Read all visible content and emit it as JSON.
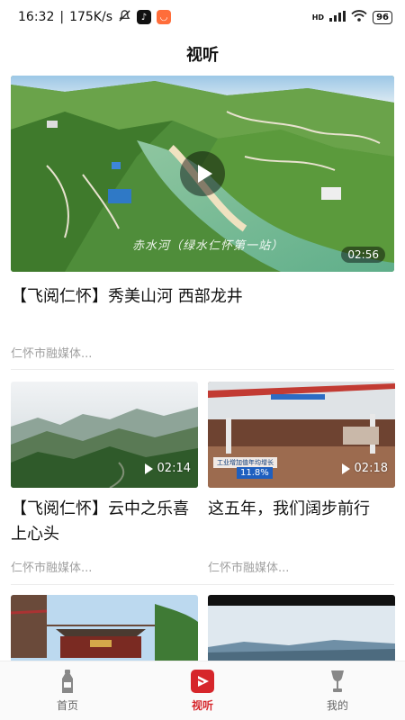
{
  "status_bar": {
    "time": "16:32",
    "network_speed": "175K/s",
    "network_type": "HD",
    "battery": "96",
    "icons": [
      "mute-icon",
      "tiktok-icon",
      "app-icon",
      "signal-icon",
      "wifi-icon",
      "battery-icon"
    ]
  },
  "header": {
    "title": "视听"
  },
  "featured": {
    "title": "【飞阅仁怀】秀美山河  西部龙井",
    "duration": "02:56",
    "source": "仁怀市融媒体...",
    "overlay_caption": "赤水河（绿水仁怀第一站）"
  },
  "grid": [
    {
      "title": "【飞阅仁怀】云中之乐喜上心头",
      "duration": "02:14",
      "source": "仁怀市融媒体..."
    },
    {
      "title": "这五年，我们阔步前行",
      "duration": "02:18",
      "source": "仁怀市融媒体...",
      "overlay_banner": "工业增加值年均增长",
      "overlay_percent": "11.8%"
    }
  ],
  "bottom_nav": [
    {
      "label": "首页",
      "icon": "bottle-icon",
      "active": false
    },
    {
      "label": "视听",
      "icon": "video-play-icon",
      "active": true
    },
    {
      "label": "我的",
      "icon": "trophy-icon",
      "active": false
    }
  ],
  "colors": {
    "accent": "#d6262b",
    "muted_text": "#a0a0a0",
    "nav_inactive": "#888888"
  }
}
